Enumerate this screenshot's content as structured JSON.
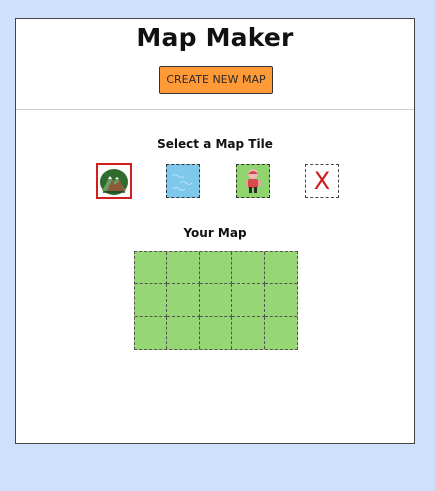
{
  "app": {
    "title": "Map Maker",
    "create_button_label": "CREATE NEW MAP"
  },
  "tile_picker": {
    "label": "Select a Map Tile",
    "tiles": [
      {
        "name": "mountain",
        "icon": "mountain-icon",
        "selected": true
      },
      {
        "name": "water",
        "icon": "water-icon",
        "selected": false
      },
      {
        "name": "player",
        "icon": "player-icon",
        "selected": false
      },
      {
        "name": "delete",
        "icon": "x-icon",
        "label": "X",
        "selected": false
      }
    ]
  },
  "map": {
    "label": "Your Map",
    "rows": 3,
    "cols": 5,
    "default_tile": "grass"
  },
  "colors": {
    "background": "#cfe0fb",
    "accent": "#ff9a37",
    "grass": "#97d674",
    "water": "#7ec8ec",
    "selected_border": "#d31e1e"
  }
}
